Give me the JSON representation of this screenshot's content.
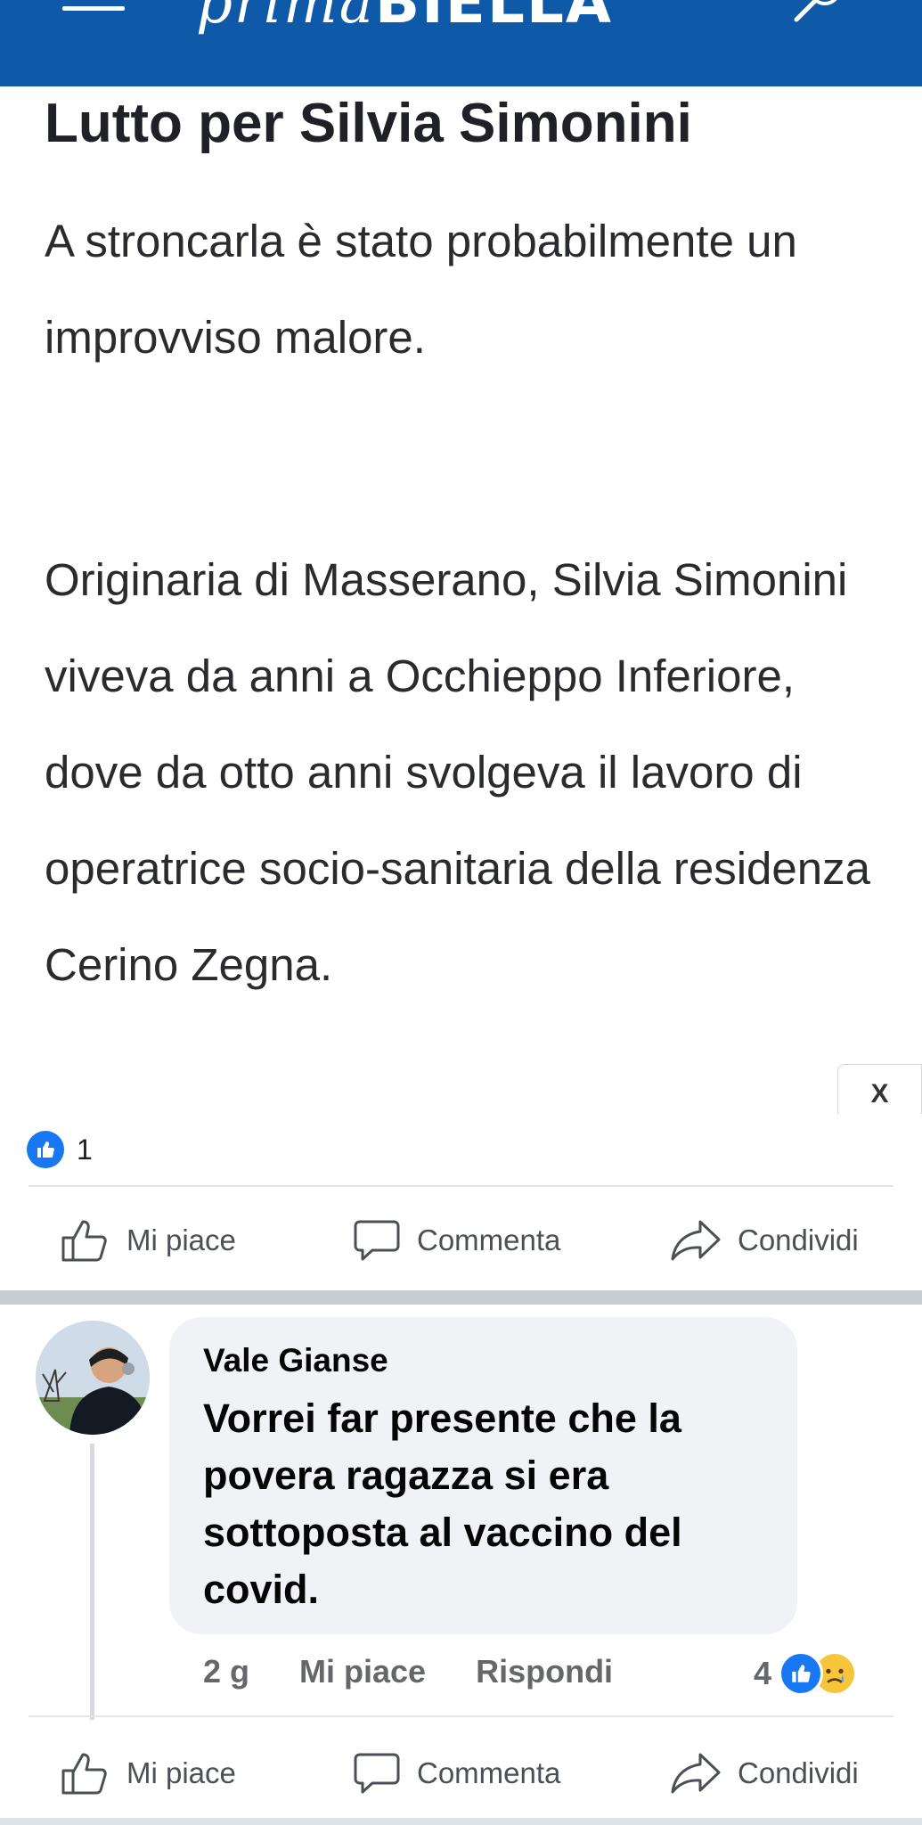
{
  "header": {
    "brand_italic": "prima",
    "brand_strong": "BIELLA",
    "colors": {
      "bar": "#0e5aa8"
    },
    "menu_icon": "hamburger-icon",
    "search_icon": "search-icon"
  },
  "article": {
    "title": "Lutto per Silvia Simonini",
    "paragraph_1": "A stroncarla è stato probabilmente un improvviso malore.",
    "paragraph_2": "Originaria di Masserano, Silvia Simonini viveva da anni a Occhieppo Inferiore, dove da otto anni svolgeva il lavoro di operatrice socio-sanitaria della residenza Cerino Zegna.",
    "ad_close": "X"
  },
  "post": {
    "reaction_count": "1",
    "actions": {
      "like": "Mi piace",
      "comment": "Commenta",
      "share": "Condividi"
    }
  },
  "comment": {
    "author": "Vale Gianse",
    "text": "Vorrei far presente che la povera ragazza si era sottoposta al vaccino del covid.",
    "time": "2 g",
    "like_label": "Mi piace",
    "reply_label": "Rispondi",
    "reaction_count": "4",
    "reaction_icons": [
      "like-icon",
      "sad-face-icon"
    ]
  },
  "bottom_actions": {
    "like": "Mi piace",
    "comment": "Commenta",
    "share": "Condividi"
  }
}
